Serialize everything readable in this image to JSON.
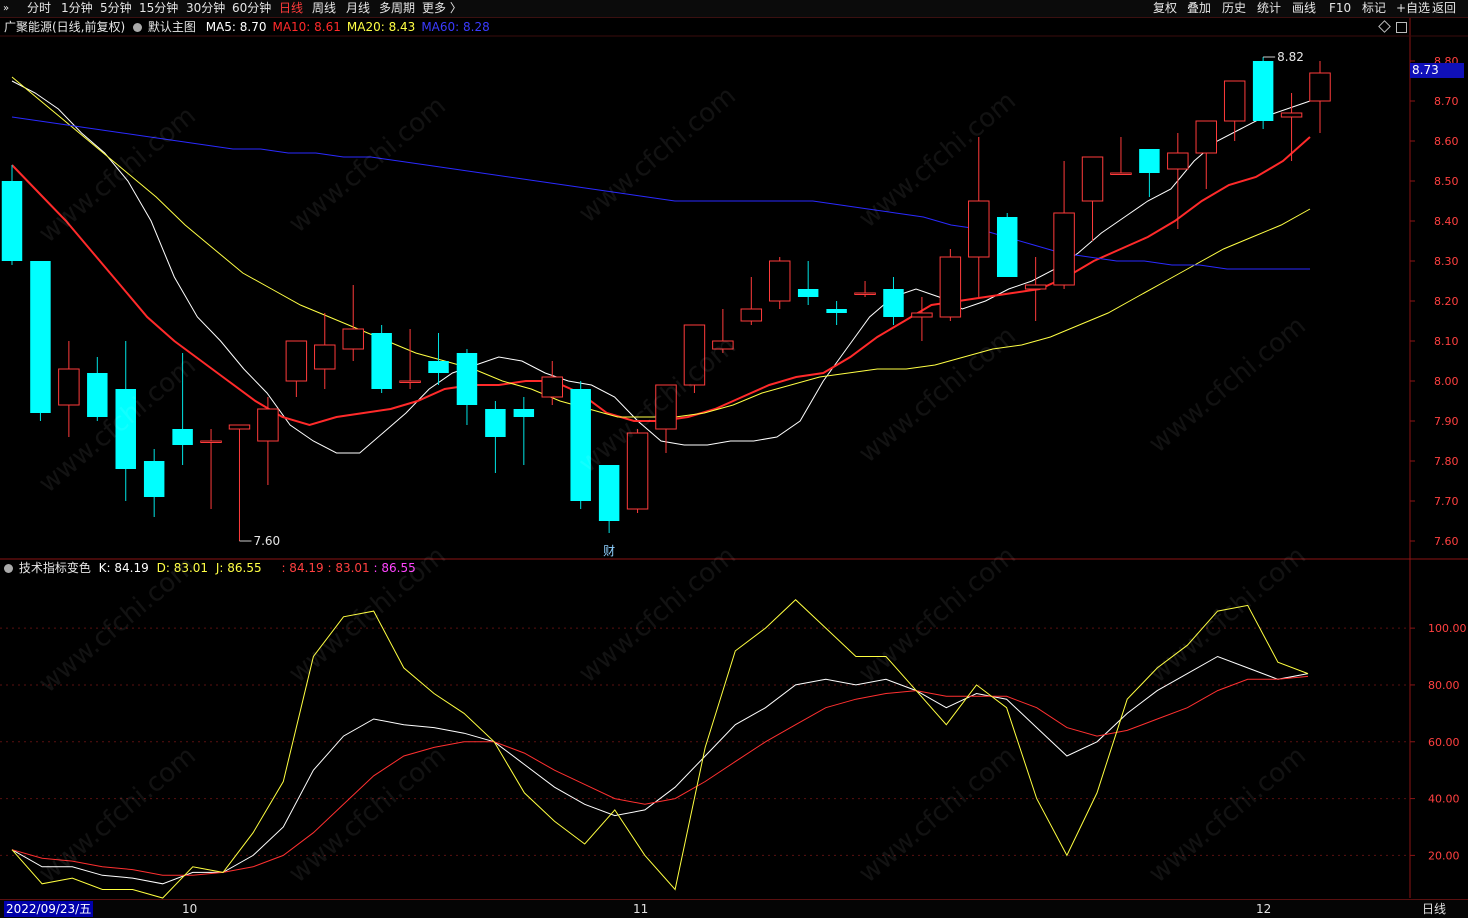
{
  "toolbar": {
    "collapse_label": "»",
    "periods": [
      {
        "label": "分时",
        "active": false
      },
      {
        "label": "1分钟",
        "active": false
      },
      {
        "label": "5分钟",
        "active": false
      },
      {
        "label": "15分钟",
        "active": false
      },
      {
        "label": "30分钟",
        "active": false
      },
      {
        "label": "60分钟",
        "active": false
      },
      {
        "label": "日线",
        "active": true
      },
      {
        "label": "周线",
        "active": false
      },
      {
        "label": "月线",
        "active": false
      },
      {
        "label": "多周期",
        "active": false
      },
      {
        "label": "更多 〉",
        "active": false
      }
    ],
    "right_buttons": [
      "复权",
      "叠加",
      "历史",
      "统计",
      "画线",
      "F10",
      "标记",
      "+自选",
      "返回"
    ]
  },
  "main_info": {
    "stock": "广聚能源(日线,前复权)",
    "template": "默认主图",
    "ma": [
      {
        "label": "MA5: 8.70",
        "color": "#ffffff"
      },
      {
        "label": "MA10: 8.61",
        "color": "#ff2a2a"
      },
      {
        "label": "MA20: 8.43",
        "color": "#ffff44"
      },
      {
        "label": "MA60: 8.28",
        "color": "#3b3bff"
      }
    ]
  },
  "indicator_info": {
    "name": "技术指标变色",
    "k": "K: 84.19",
    "d": "D: 83.01",
    "j": "J: 86.55",
    "extra": ": 84.19 : 83.01 : 86.55"
  },
  "price_tag": "8.73",
  "max_label": "8.82",
  "min_label": "7.60",
  "event_label": "财",
  "dates": {
    "start": "2022/09/23/五",
    "m10": "10",
    "m11": "11",
    "m12": "12",
    "period": "日线"
  },
  "chart_data": [
    {
      "type": "candlestick",
      "ylim": [
        7.56,
        8.86
      ],
      "yticks": [
        7.6,
        7.7,
        7.8,
        7.9,
        8.0,
        8.1,
        8.2,
        8.3,
        8.4,
        8.5,
        8.6,
        8.7,
        8.8
      ],
      "candles": [
        [
          8.5,
          8.54,
          8.29,
          8.3
        ],
        [
          8.3,
          8.3,
          7.9,
          7.92
        ],
        [
          7.94,
          8.1,
          7.86,
          8.03
        ],
        [
          8.02,
          8.06,
          7.9,
          7.91
        ],
        [
          7.98,
          8.1,
          7.7,
          7.78
        ],
        [
          7.8,
          7.83,
          7.66,
          7.71
        ],
        [
          7.88,
          8.07,
          7.79,
          7.84
        ],
        [
          7.85,
          7.88,
          7.68,
          7.85
        ],
        [
          7.88,
          7.89,
          7.6,
          7.89
        ],
        [
          7.85,
          7.96,
          7.74,
          7.93
        ],
        [
          8.0,
          8.1,
          7.96,
          8.1
        ],
        [
          8.03,
          8.17,
          7.98,
          8.09
        ],
        [
          8.08,
          8.24,
          8.05,
          8.13
        ],
        [
          8.12,
          8.14,
          7.97,
          7.98
        ],
        [
          8.0,
          8.13,
          7.98,
          8.0
        ],
        [
          8.05,
          8.12,
          7.99,
          8.02
        ],
        [
          8.07,
          8.08,
          7.89,
          7.94
        ],
        [
          7.93,
          7.95,
          7.77,
          7.86
        ],
        [
          7.93,
          7.96,
          7.79,
          7.91
        ],
        [
          7.96,
          8.05,
          7.94,
          8.01
        ],
        [
          7.98,
          8.0,
          7.68,
          7.7
        ],
        [
          7.79,
          7.79,
          7.62,
          7.65
        ],
        [
          7.68,
          7.88,
          7.67,
          7.87
        ],
        [
          7.88,
          7.99,
          7.82,
          7.99
        ],
        [
          7.99,
          8.14,
          7.97,
          8.14
        ],
        [
          8.08,
          8.18,
          8.07,
          8.1
        ],
        [
          8.15,
          8.26,
          8.14,
          8.18
        ],
        [
          8.2,
          8.31,
          8.18,
          8.3
        ],
        [
          8.23,
          8.3,
          8.19,
          8.21
        ],
        [
          8.18,
          8.2,
          8.14,
          8.17
        ],
        [
          8.22,
          8.25,
          8.21,
          8.22
        ],
        [
          8.23,
          8.26,
          8.14,
          8.16
        ],
        [
          8.16,
          8.21,
          8.1,
          8.17
        ],
        [
          8.16,
          8.33,
          8.15,
          8.31
        ],
        [
          8.31,
          8.61,
          8.21,
          8.45
        ],
        [
          8.41,
          8.42,
          8.26,
          8.26
        ],
        [
          8.23,
          8.31,
          8.15,
          8.24
        ],
        [
          8.24,
          8.55,
          8.23,
          8.42
        ],
        [
          8.45,
          8.56,
          8.35,
          8.56
        ],
        [
          8.52,
          8.61,
          8.52,
          8.52
        ],
        [
          8.58,
          8.58,
          8.46,
          8.52
        ],
        [
          8.53,
          8.62,
          8.38,
          8.57
        ],
        [
          8.57,
          8.59,
          8.48,
          8.65
        ],
        [
          8.65,
          8.73,
          8.6,
          8.75
        ],
        [
          8.8,
          8.81,
          8.63,
          8.65
        ],
        [
          8.66,
          8.72,
          8.55,
          8.67
        ],
        [
          8.7,
          8.8,
          8.62,
          8.77
        ]
      ],
      "series": [
        {
          "name": "MA5",
          "color": "#ffffff",
          "values": [
            8.75,
            8.72,
            8.68,
            8.62,
            8.57,
            8.5,
            8.4,
            8.26,
            8.16,
            8.1,
            8.03,
            7.97,
            7.89,
            7.85,
            7.82,
            7.82,
            7.87,
            7.92,
            7.98,
            8.02,
            8.04,
            8.06,
            8.05,
            8.02,
            8.0,
            7.99,
            7.96,
            7.9,
            7.85,
            7.84,
            7.84,
            7.85,
            7.85,
            7.86,
            7.9,
            8.0,
            8.08,
            8.16,
            8.21,
            8.23,
            8.21,
            8.18,
            8.2,
            8.23,
            8.25,
            8.28,
            8.32,
            8.37,
            8.41,
            8.45,
            8.48,
            8.55,
            8.6,
            8.63,
            8.66,
            8.68,
            8.7
          ]
        },
        {
          "name": "MA10",
          "color": "#ff2a2a",
          "values": [
            8.54,
            8.47,
            8.4,
            8.32,
            8.24,
            8.16,
            8.1,
            8.05,
            8.0,
            7.95,
            7.91,
            7.89,
            7.91,
            7.92,
            7.93,
            7.95,
            7.98,
            7.99,
            7.99,
            8.0,
            8.0,
            7.97,
            7.92,
            7.9,
            7.9,
            7.91,
            7.93,
            7.96,
            7.99,
            8.01,
            8.02,
            8.06,
            8.11,
            8.15,
            8.19,
            8.2,
            8.21,
            8.22,
            8.23,
            8.26,
            8.3,
            8.33,
            8.36,
            8.4,
            8.45,
            8.49,
            8.51,
            8.55,
            8.61
          ]
        },
        {
          "name": "MA20",
          "color": "#ffff44",
          "values": [
            8.76,
            8.7,
            8.64,
            8.58,
            8.52,
            8.46,
            8.39,
            8.33,
            8.27,
            8.23,
            8.19,
            8.16,
            8.13,
            8.1,
            8.07,
            8.05,
            8.03,
            8.0,
            7.98,
            7.95,
            7.93,
            7.91,
            7.91,
            7.91,
            7.92,
            7.94,
            7.97,
            7.99,
            8.01,
            8.02,
            8.03,
            8.03,
            8.04,
            8.06,
            8.08,
            8.09,
            8.11,
            8.14,
            8.17,
            8.21,
            8.25,
            8.29,
            8.33,
            8.36,
            8.39,
            8.43
          ]
        },
        {
          "name": "MA60",
          "color": "#2a2aff",
          "values": [
            8.66,
            8.65,
            8.64,
            8.63,
            8.62,
            8.61,
            8.6,
            8.59,
            8.58,
            8.58,
            8.57,
            8.57,
            8.56,
            8.56,
            8.55,
            8.54,
            8.53,
            8.52,
            8.51,
            8.5,
            8.49,
            8.48,
            8.47,
            8.46,
            8.45,
            8.45,
            8.45,
            8.45,
            8.45,
            8.45,
            8.44,
            8.43,
            8.42,
            8.41,
            8.39,
            8.38,
            8.36,
            8.34,
            8.32,
            8.31,
            8.3,
            8.3,
            8.29,
            8.29,
            8.28,
            8.28,
            8.28,
            8.28
          ]
        }
      ]
    },
    {
      "type": "line",
      "ylim": [
        5,
        118
      ],
      "yticks": [
        20.0,
        40.0,
        60.0,
        80.0,
        100.0
      ],
      "series": [
        {
          "name": "K",
          "color": "#ffffff",
          "values": [
            22,
            16,
            16,
            13,
            12,
            10,
            14,
            14,
            20,
            30,
            50,
            62,
            68,
            66,
            65,
            63,
            60,
            52,
            44,
            38,
            34,
            36,
            44,
            55,
            66,
            72,
            80,
            82,
            80,
            82,
            78,
            72,
            77,
            75,
            65,
            55,
            60,
            70,
            78,
            84,
            90,
            86,
            82,
            84
          ]
        },
        {
          "name": "D",
          "color": "#ff3030",
          "values": [
            22,
            19,
            18,
            16,
            15,
            13,
            13,
            14,
            16,
            20,
            28,
            38,
            48,
            55,
            58,
            60,
            60,
            56,
            50,
            45,
            40,
            38,
            40,
            46,
            53,
            60,
            66,
            72,
            75,
            77,
            78,
            76,
            76,
            76,
            72,
            65,
            62,
            64,
            68,
            72,
            78,
            82,
            82,
            83
          ]
        },
        {
          "name": "J",
          "color": "#ffff40",
          "values": [
            22,
            10,
            12,
            8,
            8,
            5,
            16,
            14,
            28,
            46,
            90,
            104,
            106,
            86,
            77,
            70,
            60,
            42,
            32,
            24,
            36,
            20,
            8,
            58,
            92,
            100,
            110,
            100,
            90,
            90,
            78,
            66,
            80,
            72,
            40,
            20,
            42,
            75,
            86,
            94,
            106,
            108,
            88,
            84
          ]
        }
      ]
    }
  ]
}
